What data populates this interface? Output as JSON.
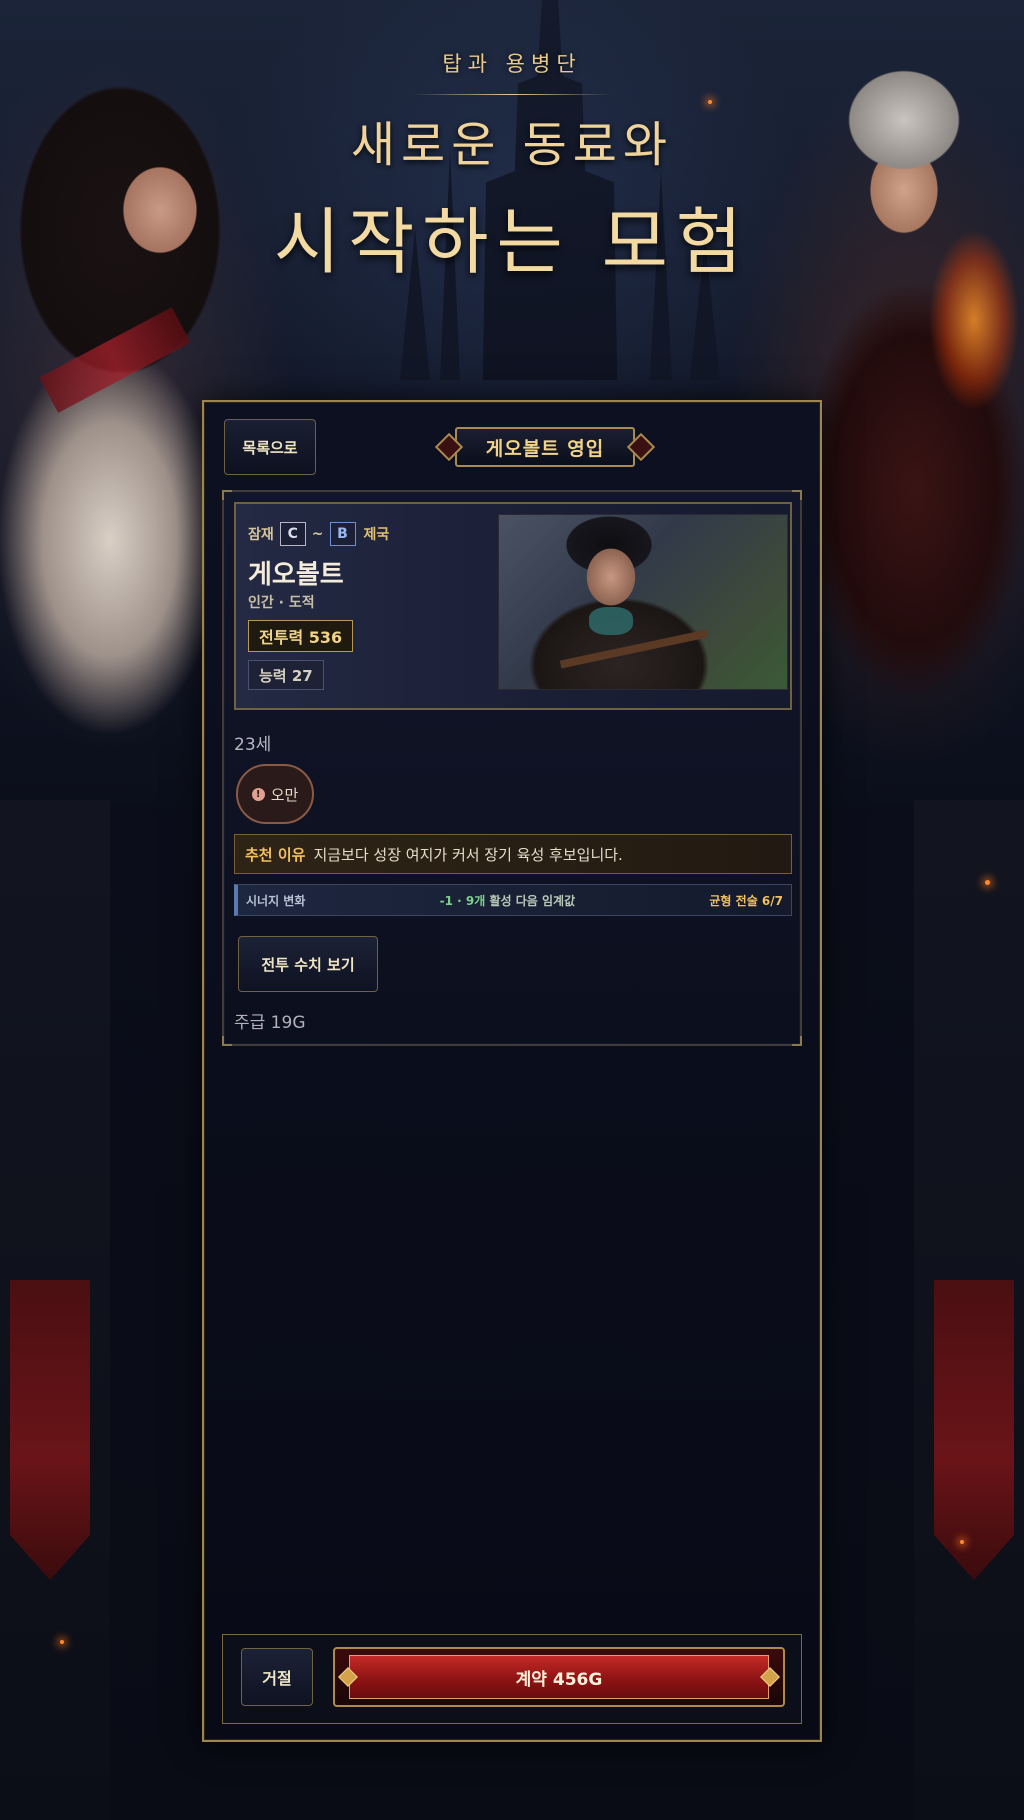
{
  "header": {
    "subtitle": "탑과 용병단",
    "title_line1": "새로운 동료와",
    "title_line2": "시작하는 모험"
  },
  "panel": {
    "back_label": "목록으로",
    "tab_title": "게오볼트 영입"
  },
  "mercenary": {
    "grade_label": "잠재",
    "grade_min": "C",
    "grade_sep": "~",
    "grade_max": "B",
    "grade_flag": "제국",
    "name": "게오볼트",
    "race_class": "인간 · 도적",
    "combat_power": "전투력 536",
    "ability": "능력 27",
    "age": "23세",
    "trait": "오만",
    "trait_icon": "alert-icon",
    "reason_key": "추천 이유",
    "reason_text": "지금보다 성장 여지가 커서 장기 육성 후보입니다.",
    "synergy_label": "시너지 변화",
    "synergy_delta": "-1 · 9개",
    "synergy_detail": "활성 다음 임계값",
    "synergy_right": "균형 전술 6/7",
    "stats_button": "전투 수치 보기",
    "wage": "주급 19G"
  },
  "footer": {
    "reject_label": "거절",
    "contract_label": "계약 456G"
  },
  "colors": {
    "gold": "#e8c98a",
    "panel_border": "#9c8550",
    "contract_red": "#c42a26",
    "synergy_green": "#7ed08a"
  }
}
